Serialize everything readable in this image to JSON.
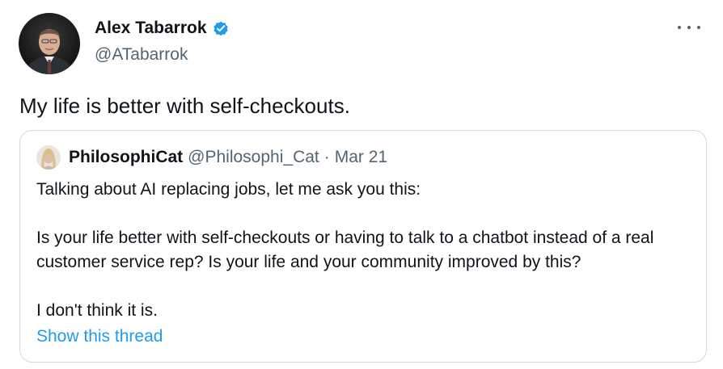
{
  "tweet": {
    "author": {
      "name": "Alex Tabarrok",
      "handle": "@ATabarrok",
      "verified": true
    },
    "text": "My life is better with self-checkouts.",
    "quoted": {
      "author": {
        "name": "PhilosophiCat",
        "handle": "@Philosophi_Cat"
      },
      "separator": "·",
      "date": "Mar 21",
      "paragraphs": [
        "Talking about AI replacing jobs, let me ask you this:",
        "Is your life better with self-checkouts or having to talk to a chatbot instead of a real customer service rep? Is your life and your community improved by this?",
        "I don't think it is."
      ],
      "show_thread_label": "Show this thread"
    }
  },
  "icons": {
    "verified": "verified-badge-icon",
    "more": "more-options-icon"
  },
  "colors": {
    "text_primary": "#0f1419",
    "text_secondary": "#536471",
    "link": "#1d9bf0",
    "border": "#cfd9de",
    "verified": "#1d9bf0"
  }
}
